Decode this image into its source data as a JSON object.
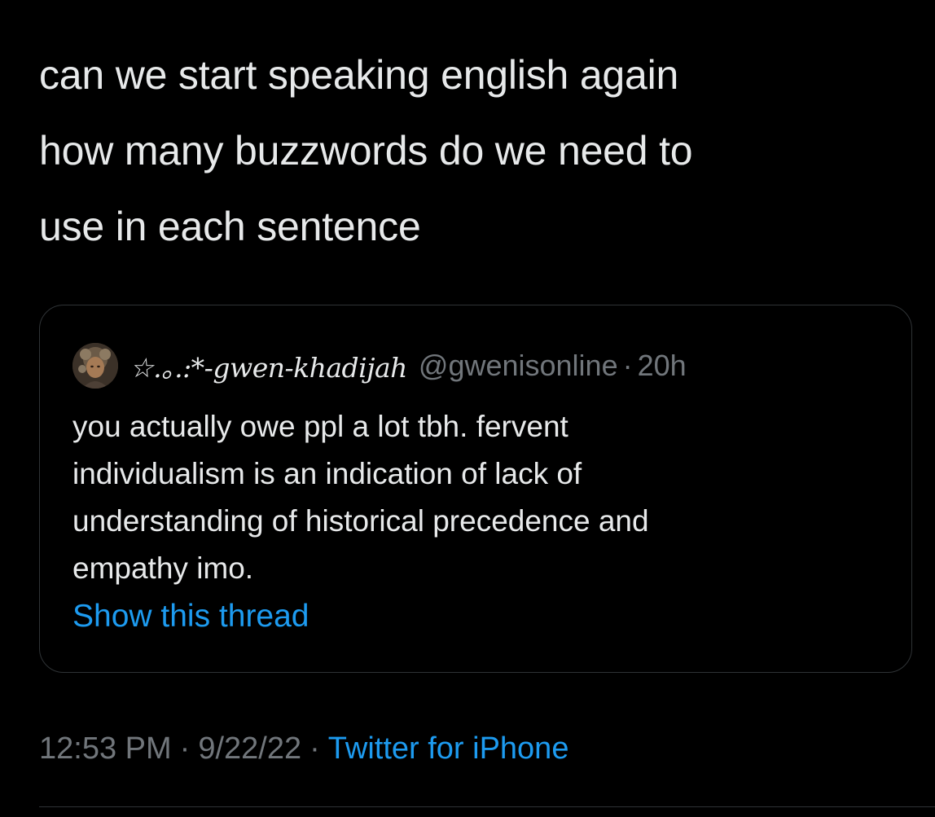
{
  "tweet": {
    "text_lines": [
      "can we start speaking english again",
      "how many buzzwords do we need to",
      "use in each sentence"
    ]
  },
  "quoted_tweet": {
    "display_name": "☆.｡.:*-gwen-khadijah",
    "handle": "@gwenisonline",
    "separator": "·",
    "age": "20h",
    "text_lines": [
      "you actually owe ppl a lot tbh. fervent",
      "individualism is an indication of lack of",
      "understanding of historical precedence and",
      "empathy imo."
    ],
    "show_thread_label": "Show this thread"
  },
  "meta": {
    "time": "12:53 PM",
    "separator": "·",
    "date": "9/22/22",
    "source": "Twitter for iPhone"
  },
  "colors": {
    "background": "#000000",
    "text": "#e7e9ea",
    "secondary": "#71767b",
    "link": "#1d9bf0",
    "border": "#2f3336"
  },
  "icons": {
    "avatar": "user-avatar-illustration"
  }
}
